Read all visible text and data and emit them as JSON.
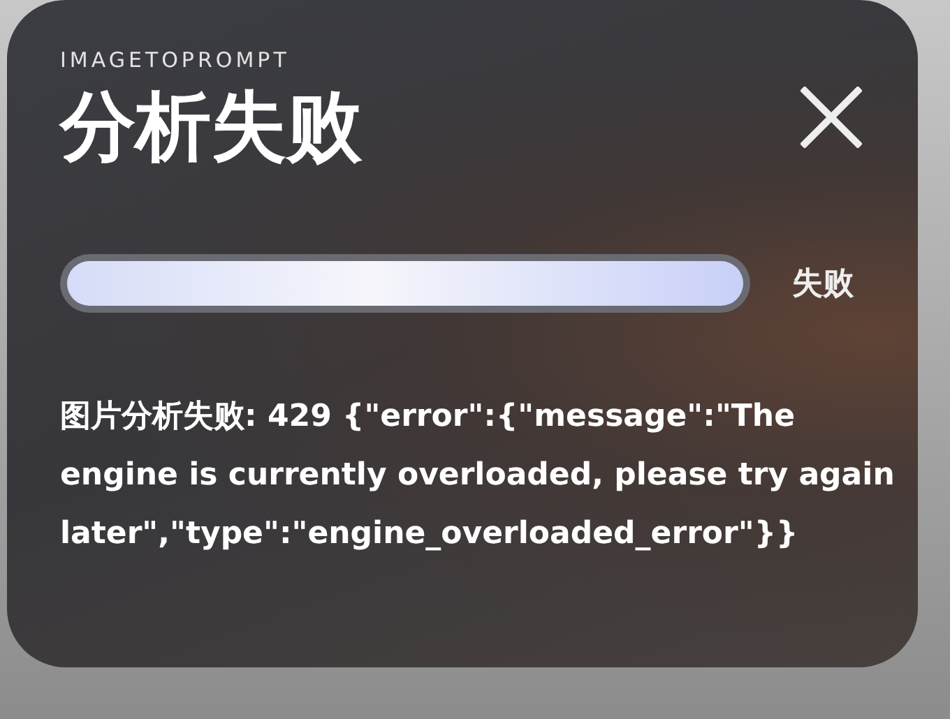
{
  "app_name": "IMAGETOPROMPT",
  "title": "分析失败",
  "progress": {
    "level": 1,
    "status": "失败"
  },
  "message": "图片分析失败: 429 {\"error\":{\"message\":\"The engine is currently overloaded, please try again later\",\"type\":\"engine_overloaded_error\"}}"
}
